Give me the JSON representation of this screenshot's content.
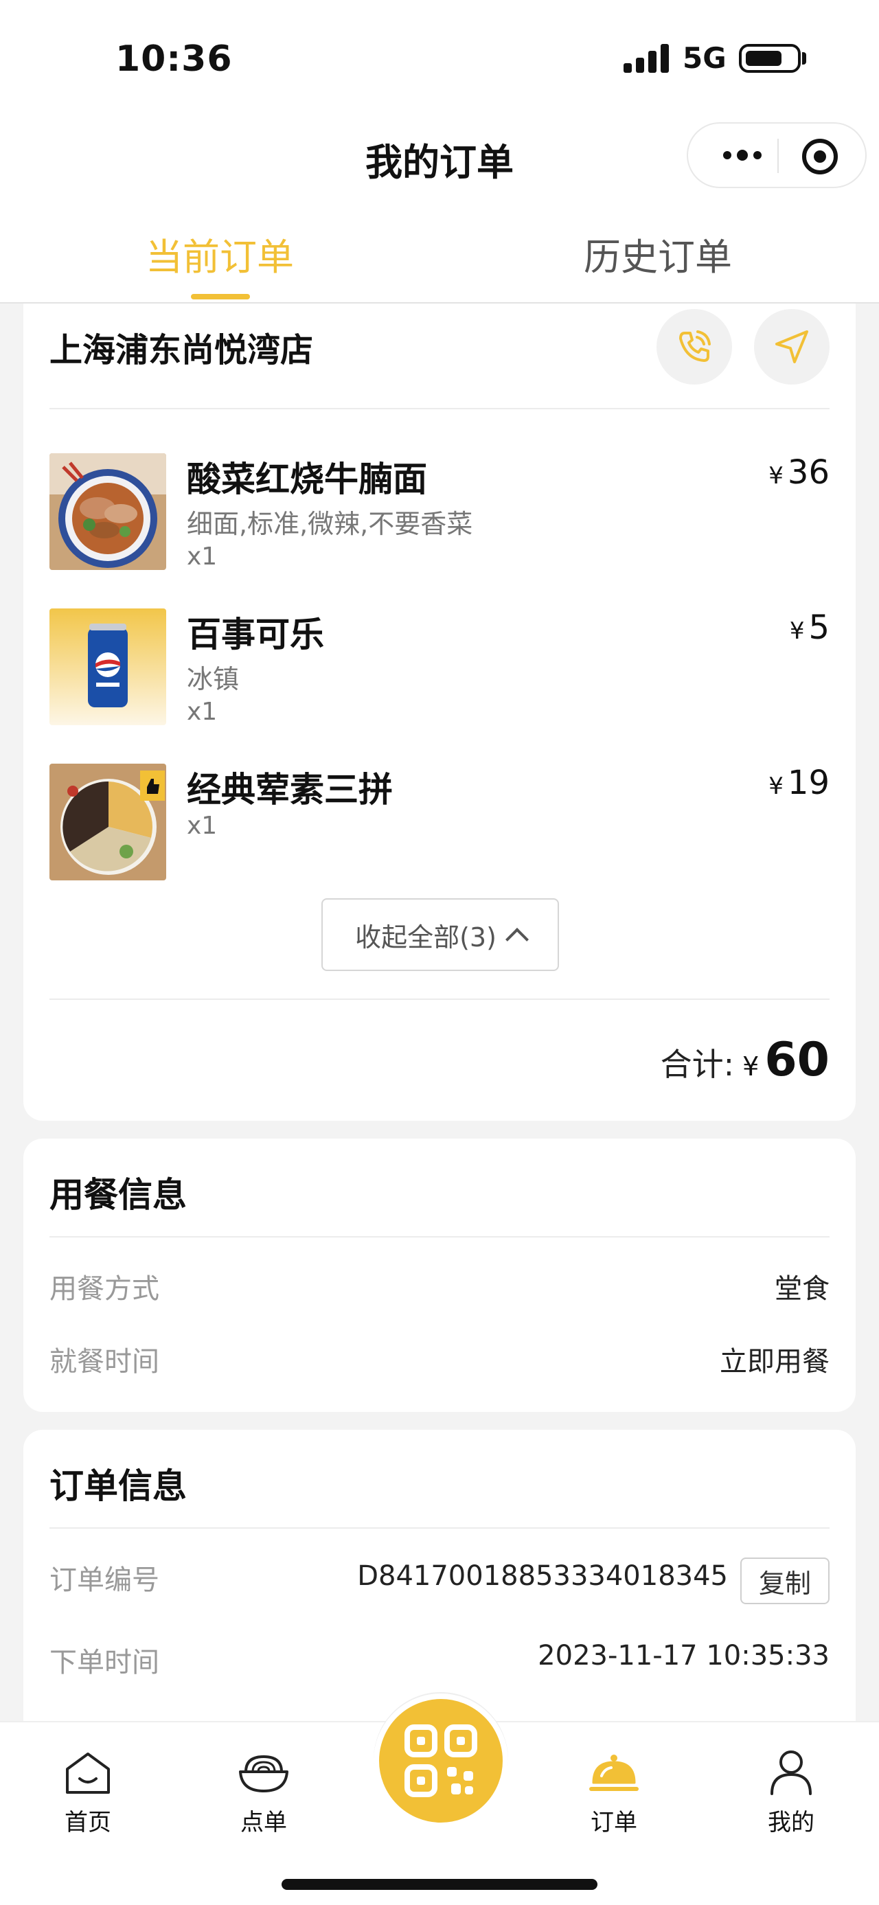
{
  "status_bar": {
    "time": "10:36",
    "network": "5G"
  },
  "nav": {
    "title": "我的订单"
  },
  "tabs": {
    "current": "当前订单",
    "history": "历史订单"
  },
  "order": {
    "store_name": "上海浦东尚悦湾店",
    "items": [
      {
        "name": "酸菜红烧牛腩面",
        "spec": "细面,标准,微辣,不要香菜",
        "qty": "x1",
        "currency": "¥",
        "price": "36",
        "image": "noodle-bowl"
      },
      {
        "name": "百事可乐",
        "spec": "冰镇",
        "qty": "x1",
        "currency": "¥",
        "price": "5",
        "image": "pepsi-can"
      },
      {
        "name": "经典荤素三拼",
        "spec": "",
        "qty": "x1",
        "currency": "¥",
        "price": "19",
        "image": "three-dish-platter"
      }
    ],
    "collapse_label": "收起全部(3)",
    "total_label": "合计:",
    "total_currency": "¥",
    "total_value": "60"
  },
  "dining": {
    "title": "用餐信息",
    "rows": [
      {
        "label": "用餐方式",
        "value": "堂食"
      },
      {
        "label": "就餐时间",
        "value": "立即用餐"
      }
    ]
  },
  "order_info": {
    "title": "订单信息",
    "number_label": "订单编号",
    "number_value": "D84170018853334018345",
    "copy_label": "复制",
    "time_label": "下单时间",
    "time_value": "2023-11-17 10:35:33"
  },
  "tabbar": {
    "items": [
      {
        "label": "首页",
        "icon": "home-icon"
      },
      {
        "label": "点单",
        "icon": "bowl-icon"
      },
      {
        "label": "订单",
        "icon": "cloche-icon",
        "active": true
      },
      {
        "label": "我的",
        "icon": "user-icon"
      }
    ],
    "center_icon": "qr-code-icon"
  },
  "colors": {
    "accent": "#f2c036",
    "background": "#f3f3f3",
    "card": "#ffffff"
  }
}
